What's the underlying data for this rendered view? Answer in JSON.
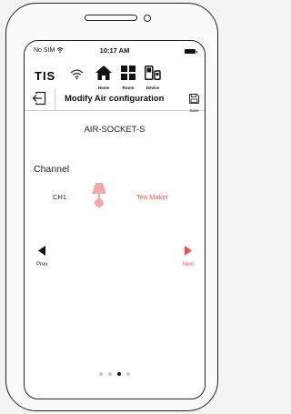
{
  "status": {
    "carrier": "No SIM",
    "time": "10:17 AM"
  },
  "app": {
    "logo": "TIS"
  },
  "nav": [
    {
      "label": "Home"
    },
    {
      "label": "Room"
    },
    {
      "label": "Device"
    }
  ],
  "header": {
    "title": "Modify Air configuration",
    "save_label": "Save"
  },
  "device": {
    "name": "AIR-SOCKET-S"
  },
  "section": {
    "title": "Channel"
  },
  "channels": [
    {
      "id": "CH1:",
      "name": "Tea Maker"
    }
  ],
  "pager": {
    "prev_label": "Prev",
    "next_label": "Next",
    "pages": 4,
    "active": 2
  },
  "colors": {
    "accent": "#ff4b4b",
    "bulb": "#f4a9a9"
  }
}
